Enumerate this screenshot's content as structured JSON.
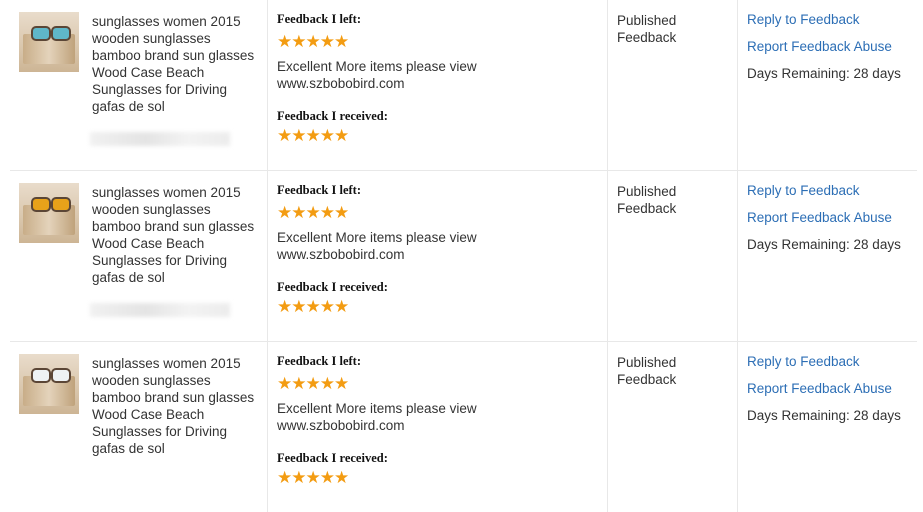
{
  "rows": [
    {
      "item_title": "sunglasses women 2015 wooden sunglasses bamboo brand sun glasses Wood Case Beach Sunglasses for Driving gafas de sol",
      "lens_color": "#5fb7c9",
      "feedback_left_label": "Feedback I left:",
      "feedback_left_stars": "★★★★★",
      "feedback_left_rating": 5,
      "feedback_left_text": "Excellent More items please view www.szbobobird.com",
      "feedback_received_label": "Feedback I received:",
      "feedback_received_stars": "★★★★★",
      "feedback_received_rating": 5,
      "status": "Published Feedback",
      "reply_link": "Reply to Feedback",
      "report_link": "Report Feedback Abuse",
      "days_remaining": "Days Remaining: 28 days"
    },
    {
      "item_title": "sunglasses women 2015 wooden sunglasses bamboo brand sun glasses Wood Case Beach Sunglasses for Driving gafas de sol",
      "lens_color": "#e8a21a",
      "feedback_left_label": "Feedback I left:",
      "feedback_left_stars": "★★★★★",
      "feedback_left_rating": 5,
      "feedback_left_text": "Excellent More items please view www.szbobobird.com",
      "feedback_received_label": "Feedback I received:",
      "feedback_received_stars": "★★★★★",
      "feedback_received_rating": 5,
      "status": "Published Feedback",
      "reply_link": "Reply to Feedback",
      "report_link": "Report Feedback Abuse",
      "days_remaining": "Days Remaining: 28 days"
    },
    {
      "item_title": "sunglasses women 2015 wooden sunglasses bamboo brand sun glasses Wood Case Beach Sunglasses for Driving gafas de sol",
      "lens_color": "#eef2f4",
      "feedback_left_label": "Feedback I left:",
      "feedback_left_stars": "★★★★★",
      "feedback_left_rating": 5,
      "feedback_left_text": "Excellent More items please view www.szbobobird.com",
      "feedback_received_label": "Feedback I received:",
      "feedback_received_stars": "★★★★★",
      "feedback_received_rating": 5,
      "status": "Published Feedback",
      "reply_link": "Reply to Feedback",
      "report_link": "Report Feedback Abuse",
      "days_remaining": "Days Remaining: 28 days"
    }
  ],
  "colors": {
    "link": "#2c6eb5",
    "star": "#f39c12",
    "text": "#333333",
    "divider": "#e8e8e8"
  }
}
